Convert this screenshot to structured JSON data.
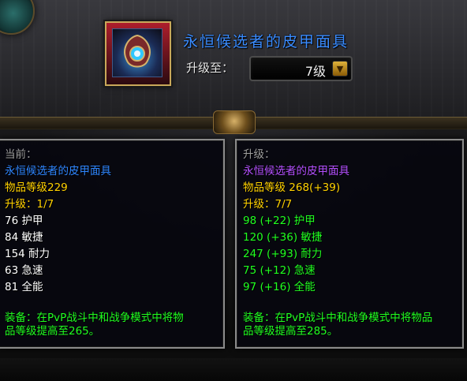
{
  "header": {
    "item_name": "永恒候选者的皮甲面具",
    "upgrade_label": "升级至：",
    "selected_level": "7级",
    "dropdown_icon": "chevron-down-icon"
  },
  "panels": {
    "current": {
      "heading": "当前：",
      "item_name": "永恒候选者的皮甲面具",
      "item_level": "物品等级229",
      "upgrade": "升级：1/7",
      "stats": [
        "76 护甲",
        "84 敏捷",
        "154 耐力",
        "63 急速",
        "81 全能"
      ],
      "equip_line1": "装备：在PvP战斗中和战争模式中将物",
      "equip_line2": "品等级提高至265。"
    },
    "upgrade": {
      "heading": "升级：",
      "item_name": "永恒候选者的皮甲面具",
      "item_level": "物品等级 268(+39)",
      "upgrade": "升级：7/7",
      "stats": [
        "98 (+22) 护甲",
        "120 (+36) 敏捷",
        "247 (+93) 耐力",
        "75 (+12) 急速",
        "97 (+16) 全能"
      ],
      "equip_line1": "装备：在PvP战斗中和战争模式中将物品",
      "equip_line2": "品等级提高至285。"
    }
  },
  "colors": {
    "title_blue": "#3a8cff",
    "epic_purple": "#b450ff",
    "rare_blue": "#2f86ff",
    "upgrade_green": "#20ff20",
    "gold": "#ffd100"
  }
}
